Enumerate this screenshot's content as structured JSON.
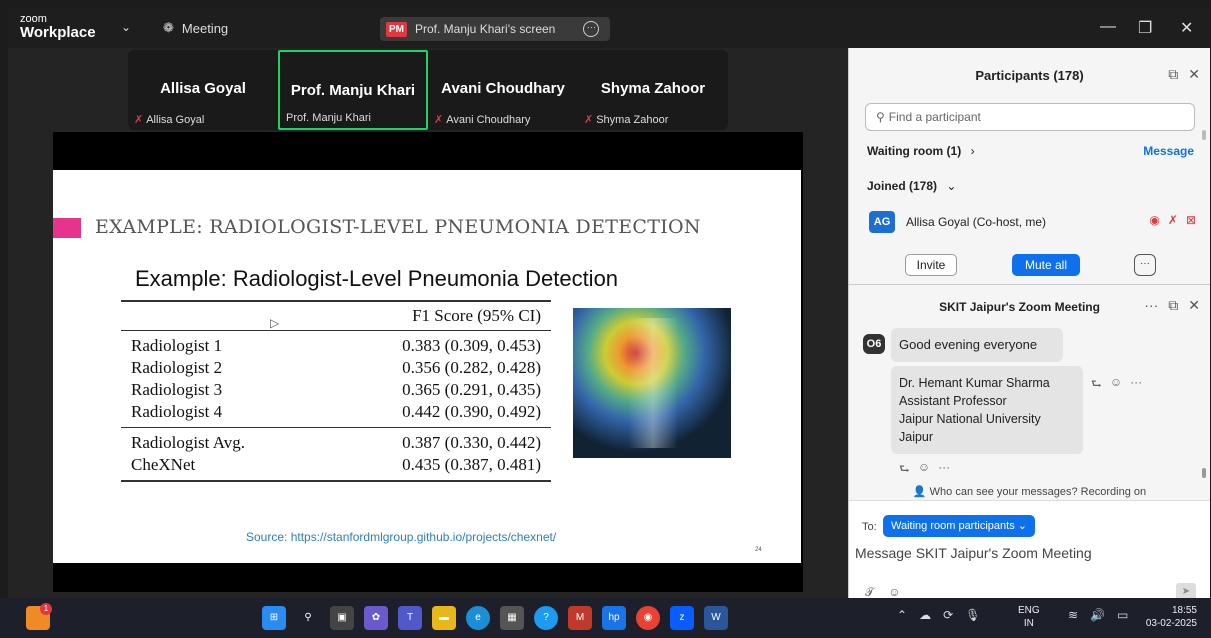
{
  "titlebar": {
    "logo_small": "zoom",
    "logo_big": "Workplace",
    "meeting_label": "Meeting",
    "share_badge": "PM",
    "share_title": "Prof. Manju Khari's screen"
  },
  "gallery": [
    {
      "big": "Allisa Goyal",
      "small": "Allisa Goyal",
      "muted": true,
      "active": false
    },
    {
      "big": "Prof. Manju Khari",
      "small": "Prof. Manju Khari",
      "muted": false,
      "active": true
    },
    {
      "big": "Avani Choudhary",
      "small": "Avani Choudhary",
      "muted": true,
      "active": false
    },
    {
      "big": "Shyma Zahoor",
      "small": "Shyma Zahoor",
      "muted": true,
      "active": false
    }
  ],
  "slide": {
    "title": "EXAMPLE: RADIOLOGIST-LEVEL PNEUMONIA DETECTION",
    "subtitle": "Example: Radiologist-Level Pneumonia Detection",
    "table_header": "F1 Score (95% CI)",
    "rows_group1": [
      {
        "name": "Radiologist 1",
        "score": "0.383 (0.309, 0.453)"
      },
      {
        "name": "Radiologist 2",
        "score": "0.356 (0.282, 0.428)"
      },
      {
        "name": "Radiologist 3",
        "score": "0.365 (0.291, 0.435)"
      },
      {
        "name": "Radiologist 4",
        "score": "0.442 (0.390, 0.492)"
      }
    ],
    "rows_group2": [
      {
        "name": "Radiologist Avg.",
        "score": "0.387 (0.330, 0.442)"
      },
      {
        "name": "CheXNet",
        "score": "0.435 (0.387, 0.481)"
      }
    ],
    "source": "Source: https://stanfordmlgroup.github.io/projects/chexnet/",
    "page": "24"
  },
  "participants": {
    "title": "Participants (178)",
    "search_placeholder": "Find a participant",
    "waiting": "Waiting room (1)",
    "message_link": "Message",
    "joined": "Joined (178)",
    "me_initials": "AG",
    "me_name": "Allisa Goyal (Co-host, me)",
    "invite": "Invite",
    "mute_all": "Mute all"
  },
  "chat": {
    "title": "SKIT Jaipur's Zoom Meeting",
    "sender_badge": "O6",
    "msg1": "Good evening everyone",
    "msg2_lines": [
      "Dr. Hemant Kumar Sharma",
      "Assistant Professor",
      "Jaipur National University",
      "Jaipur"
    ],
    "who_can_see": "Who can see your messages? Recording on",
    "to_label": "To:",
    "to_value": "Waiting room participants",
    "compose_placeholder": "Message SKIT Jaipur's Zoom Meeting"
  },
  "taskbar": {
    "notif_count": "1",
    "lang_top": "ENG",
    "lang_bottom": "IN",
    "time": "18:55",
    "date": "03-02-2025"
  }
}
